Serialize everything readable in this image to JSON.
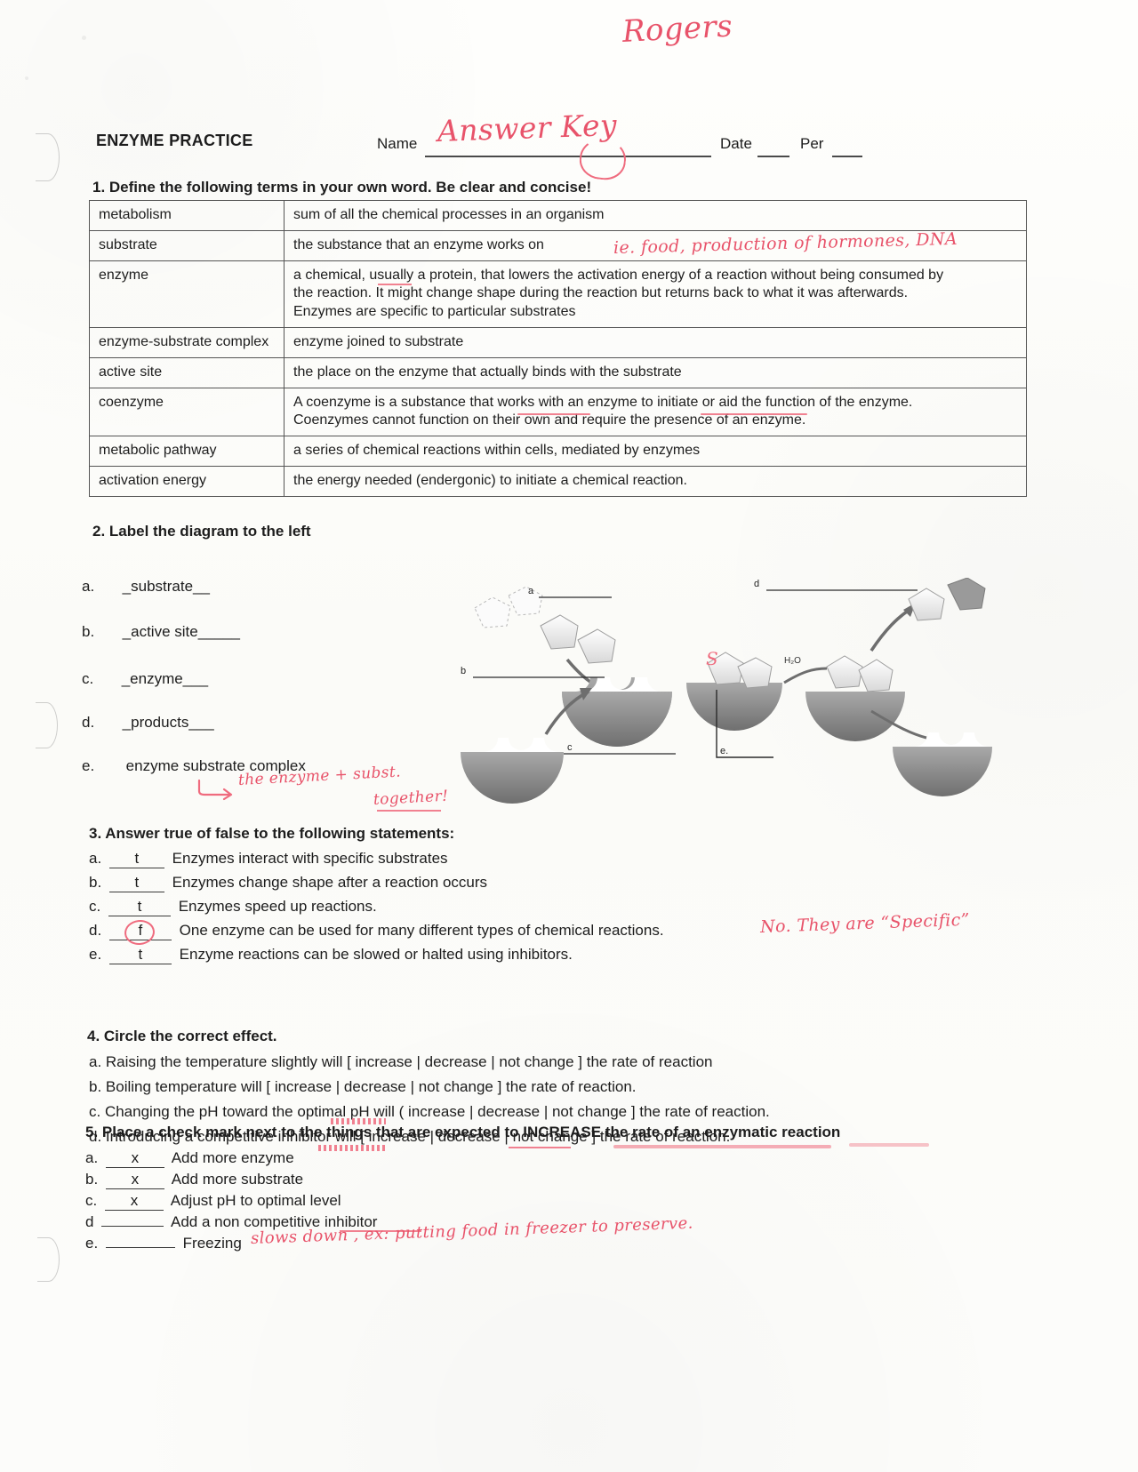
{
  "header": {
    "teacher_signature": "Rogers",
    "title": "ENZYME PRACTICE",
    "name_label": "Name",
    "name_value": "Answer Key",
    "date_label": "Date",
    "per_label": "Per"
  },
  "q1": {
    "heading": "1. Define the following terms in your own word.  Be clear and concise!",
    "handwritten_note": "ie. food, production of hormones, DNA",
    "rows": [
      {
        "term": "metabolism",
        "lines": [
          "sum of all the chemical processes in an organism"
        ]
      },
      {
        "term": "substrate",
        "lines": [
          "the substance that an enzyme works on"
        ]
      },
      {
        "term": "enzyme",
        "lines": [
          "a chemical, usually a protein, that lowers the activation energy of a reaction without being consumed by",
          "the reaction. It might change shape during the reaction but returns back to what it was afterwards.",
          "Enzymes are specific to particular substrates"
        ]
      },
      {
        "term": "enzyme-substrate complex",
        "lines": [
          "enzyme joined to substrate"
        ]
      },
      {
        "term": "active site",
        "lines": [
          "the place on the enzyme that actually binds with the substrate"
        ]
      },
      {
        "term": "coenzyme",
        "lines": [
          "A coenzyme is a substance that works with an enzyme to initiate or aid the function of the enzyme.",
          "Coenzymes cannot function on their own and require the presence of an enzyme."
        ]
      },
      {
        "term": "metabolic pathway",
        "lines": [
          "a series of chemical reactions within cells, mediated by enzymes"
        ]
      },
      {
        "term": "activation energy",
        "lines": [
          "the energy needed (endergonic) to initiate a chemical reaction."
        ]
      }
    ]
  },
  "q2": {
    "heading": "2. Label the diagram to the left",
    "items": [
      {
        "letter": "a.",
        "answer": "_substrate__"
      },
      {
        "letter": "b.",
        "answer": "_active site_____"
      },
      {
        "letter": "c.",
        "answer": "_enzyme___"
      },
      {
        "letter": "d.",
        "answer": "_products___"
      },
      {
        "letter": "e.",
        "answer": "enzyme substrate complex"
      }
    ],
    "handwritten_note_line1": "the enzyme + subst.",
    "handwritten_note_line2": "together!",
    "diagram_labels": {
      "a": "a",
      "b": "b",
      "c": "c",
      "d": "d",
      "e": "e.",
      "water": "H₂O",
      "substrate_mark": "S"
    }
  },
  "q3": {
    "heading": "3. Answer true of false to the following statements:",
    "handwritten_note": "No.  They are “Specific”",
    "rows": [
      {
        "letter": "a.",
        "answer": "t",
        "text": "Enzymes interact with specific substrates"
      },
      {
        "letter": "b.",
        "answer": "t",
        "text": "Enzymes change shape after a reaction occurs"
      },
      {
        "letter": "c.",
        "answer": "t",
        "text": "Enzymes speed up reactions."
      },
      {
        "letter": "d.",
        "answer": "f",
        "text": "One enzyme can be used for many different types of chemical reactions."
      },
      {
        "letter": "e.",
        "answer": "t",
        "text": "Enzyme reactions can be slowed or halted using inhibitors."
      }
    ]
  },
  "q4": {
    "heading": "4. Circle the correct effect.",
    "rows": [
      "a. Raising the temperature slightly will [ increase | decrease | not change ] the rate of reaction",
      "b. Boiling temperature will [ increase | decrease | not change ] the rate of reaction.",
      "c. Changing the pH toward the optimal pH will ( increase | decrease | not change ] the rate of reaction.",
      "d. Introducing a competitive inhibitor will [ increase | decrease | not change ] the rate of reaction."
    ]
  },
  "q5": {
    "heading": "5. Place a check mark next to the things that are expected to INCREASE the rate of an enzymatic reaction",
    "rows": [
      {
        "letter": "a.",
        "mark": "x",
        "text": "Add more enzyme"
      },
      {
        "letter": "b.",
        "mark": "x",
        "text": "Add more substrate"
      },
      {
        "letter": "c.",
        "mark": "x",
        "text": "Adjust pH to optimal level"
      },
      {
        "letter": "d",
        "mark": "",
        "text": "Add a non competitive inhibitor"
      },
      {
        "letter": "e.",
        "mark": "",
        "text": "Freezing"
      }
    ],
    "handwritten_note": "slows down , ex: putting food in freezer  to preserve."
  },
  "colors": {
    "ink_red": "#ef6b7e",
    "text_black": "#1d1d1d",
    "paper": "#fdfdfb"
  }
}
